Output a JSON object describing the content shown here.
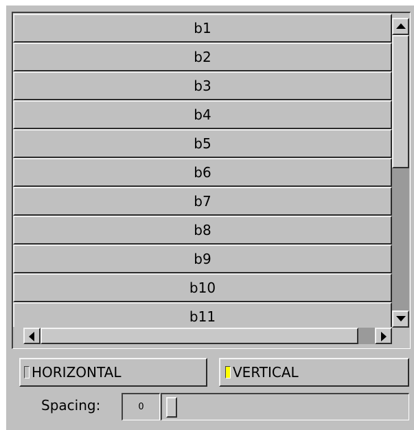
{
  "scroll_group": {
    "buttons": [
      "b1",
      "b2",
      "b3",
      "b4",
      "b5",
      "b6",
      "b7",
      "b8",
      "b9",
      "b10",
      "b11"
    ]
  },
  "orientation": {
    "horizontal_label": "HORIZONTAL",
    "vertical_label": "VERTICAL",
    "selected": "VERTICAL"
  },
  "spacing": {
    "label": "Spacing:",
    "value": "0"
  },
  "colors": {
    "background": "#c0c0c0",
    "scroll_trough": "#9a9a9a",
    "radio_selected": "#ffff00"
  },
  "icons": {
    "scroll_up": "arrow-up-icon",
    "scroll_down": "arrow-down-icon",
    "scroll_left": "arrow-left-icon",
    "scroll_right": "arrow-right-icon"
  }
}
